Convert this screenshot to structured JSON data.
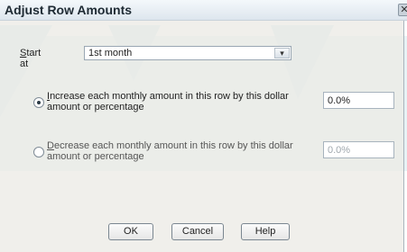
{
  "dialog": {
    "title": "Adjust Row Amounts",
    "close_glyph": "✕",
    "start_at": {
      "label_first": "S",
      "label_rest": "tart at",
      "selected_value": "1st month",
      "dropdown_glyph": "▾"
    },
    "increase_option": {
      "label_first": "I",
      "label_line1_rest": "ncrease each monthly amount in this row by this dollar",
      "label_line2": "amount or percentage",
      "value": "0.0%",
      "checked": true
    },
    "decrease_option": {
      "label_first": "D",
      "label_line1_rest": "ecrease each monthly amount in this row by this dollar",
      "label_line2": "amount or percentage",
      "value": "0.0%",
      "checked": false
    },
    "buttons": {
      "ok": "OK",
      "cancel": "Cancel",
      "help": "Help"
    }
  }
}
